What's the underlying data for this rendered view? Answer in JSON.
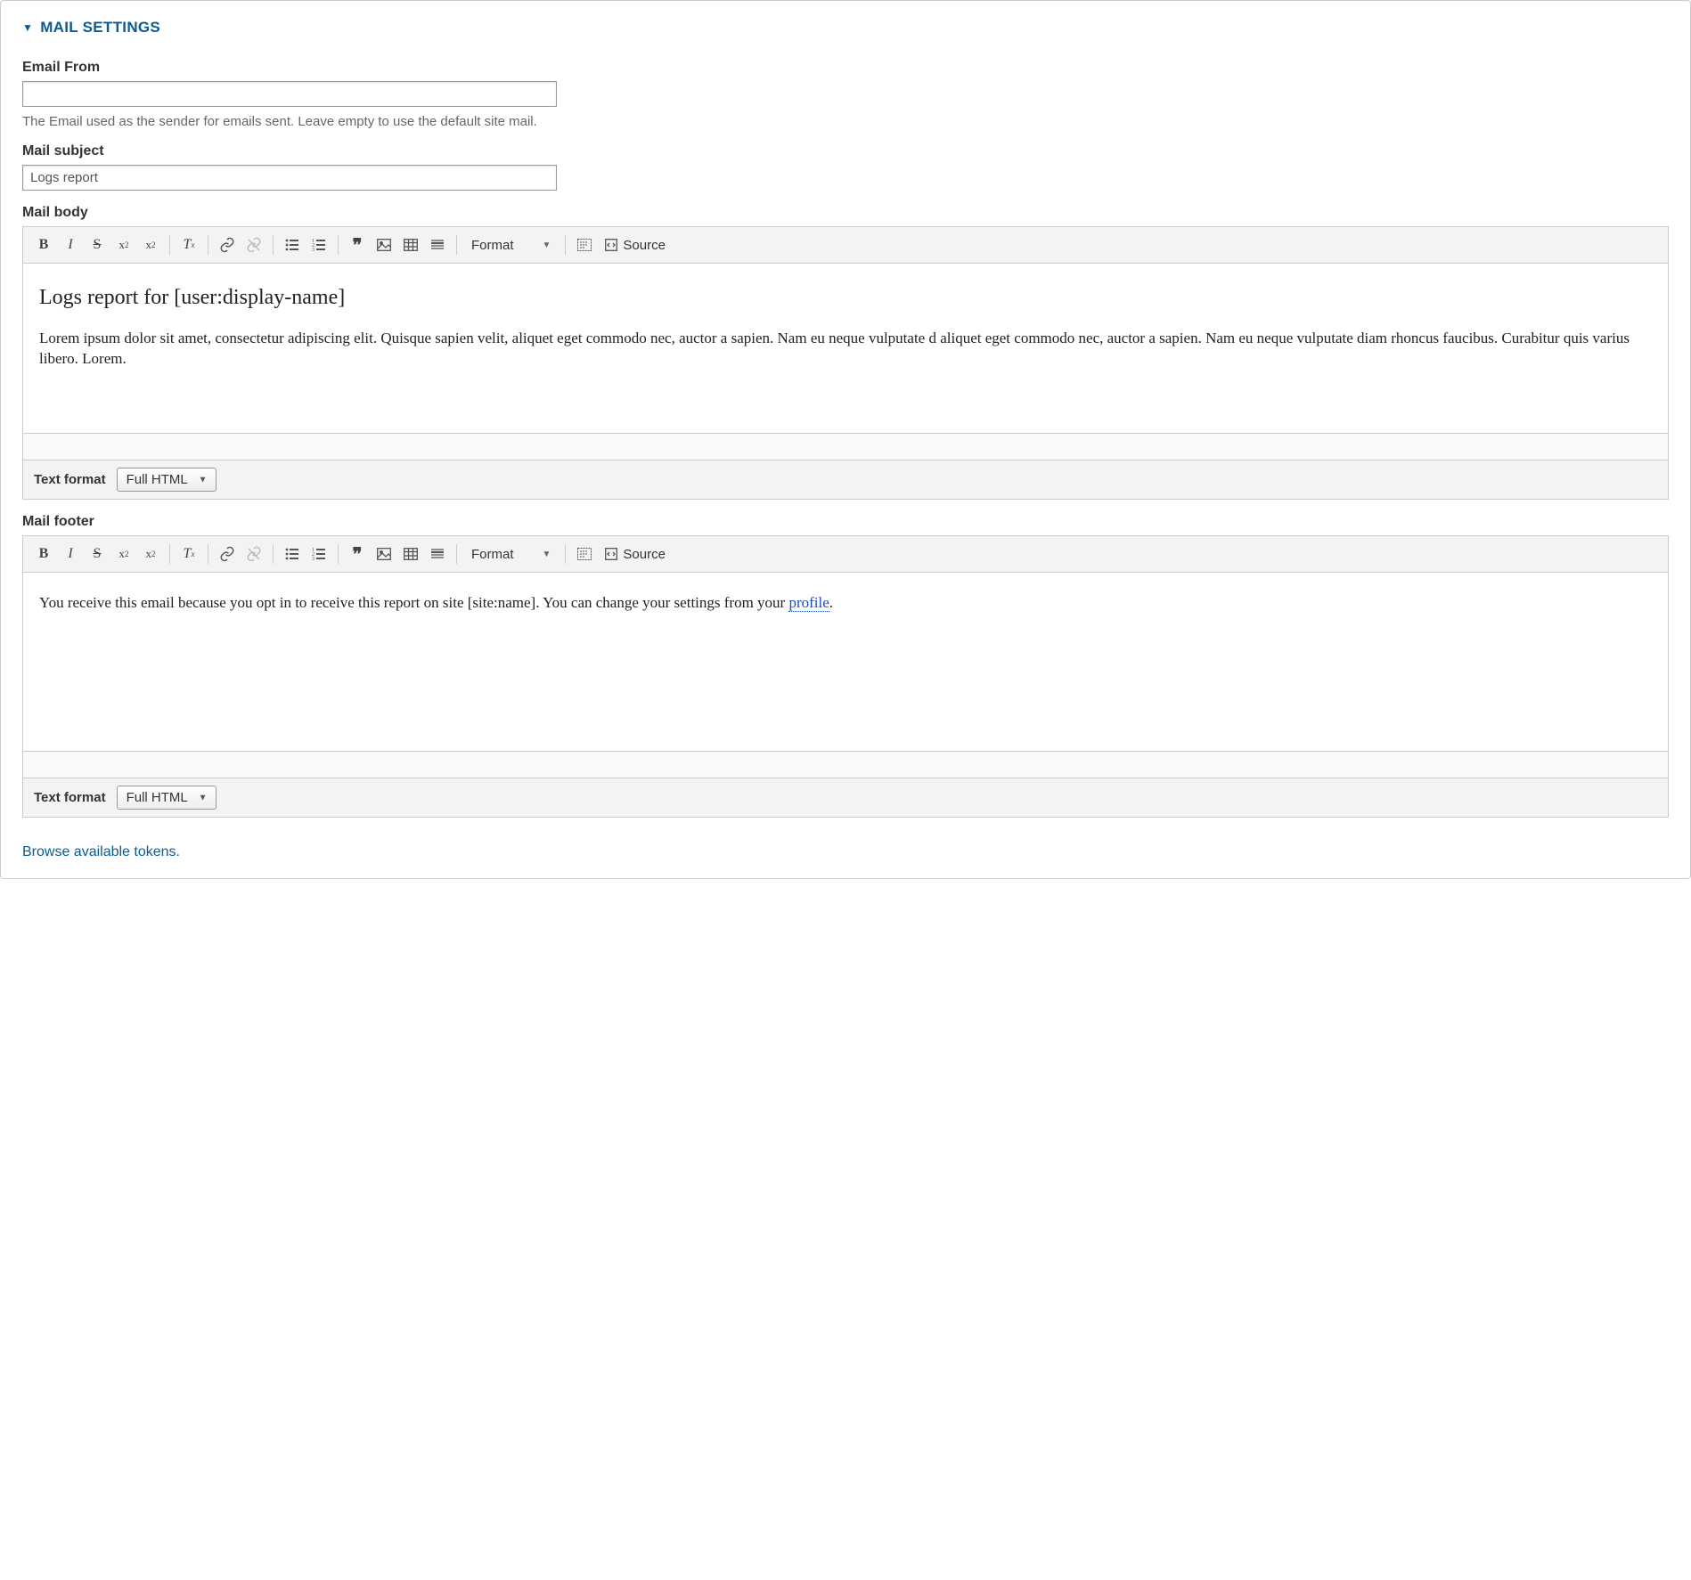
{
  "section": {
    "title": "MAIL SETTINGS"
  },
  "email_from": {
    "label": "Email From",
    "value": "",
    "help": "The Email used as the sender for emails sent. Leave empty to use the default site mail."
  },
  "mail_subject": {
    "label": "Mail subject",
    "value": "Logs report"
  },
  "mail_body": {
    "label": "Mail body",
    "content_heading": "Logs report for [user:display-name]",
    "content_para": "Lorem ipsum dolor sit amet, consectetur adipiscing elit. Quisque sapien velit, aliquet eget commodo nec, auctor a sapien. Nam eu neque vulputate d aliquet eget commodo nec, auctor a sapien. Nam eu neque vulputate diam rhoncus faucibus. Curabitur quis varius libero. Lorem."
  },
  "mail_footer": {
    "label": "Mail footer",
    "content_text": "You receive this email because you opt in to receive this report on site [site:name]. You can change your settings from your ",
    "link_text": "profile",
    "content_suffix": "."
  },
  "toolbar": {
    "format_label": "Format",
    "source_label": "Source"
  },
  "text_format": {
    "label": "Text format",
    "value": "Full HTML"
  },
  "tokens_link": "Browse available tokens."
}
